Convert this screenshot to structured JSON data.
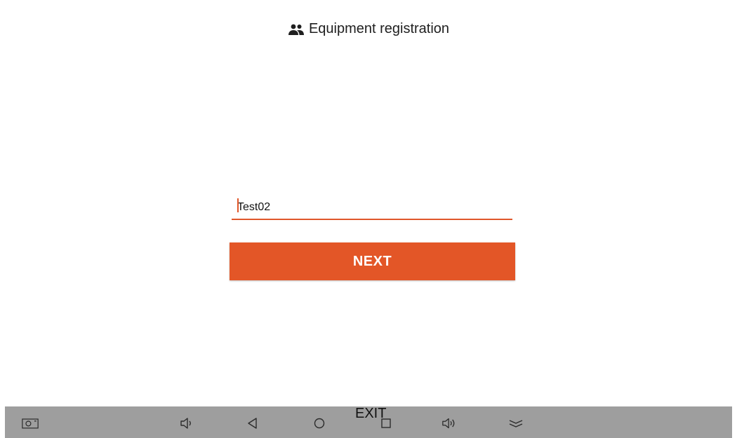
{
  "header": {
    "icon": "people-icon",
    "title": "Equipment registration"
  },
  "form": {
    "device_name_value": "Test02",
    "next_label": "NEXT"
  },
  "nav_bar": {
    "exit_label": "EXIT",
    "icons": [
      "screenshot-icon",
      "volume-down-icon",
      "back-icon",
      "home-icon",
      "recents-icon",
      "volume-up-icon",
      "collapse-icon"
    ]
  },
  "colors": {
    "accent": "#e35627",
    "nav_bar_bg": "#9e9e9e"
  }
}
